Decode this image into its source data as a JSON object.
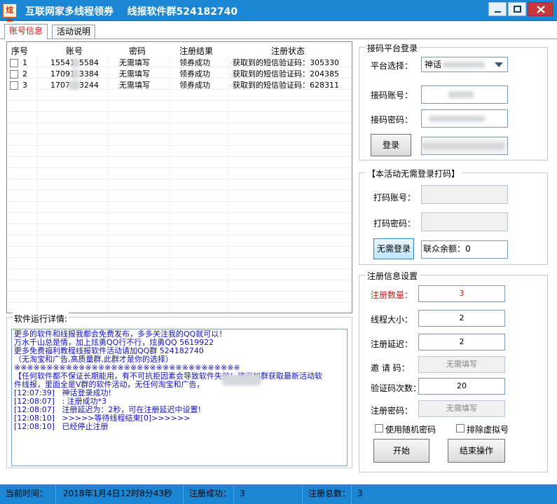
{
  "window": {
    "icon_text": "炫勇",
    "title": "互联网家多线程领券    线报软件群524182740",
    "controls": [
      "minimize",
      "maximize",
      "close"
    ]
  },
  "tabs": [
    {
      "label": "账号信息",
      "active": true
    },
    {
      "label": "活动说明",
      "active": false
    }
  ],
  "accounts": {
    "columns": [
      "序号",
      "账号",
      "密码",
      "注册结果",
      "注册状态"
    ],
    "rows": [
      {
        "index": "1",
        "account_prefix": "15541",
        "account_suffix": "5584",
        "password": "无需填写",
        "result": "领券成功",
        "status": "获取到的短信验证码：305330"
      },
      {
        "index": "2",
        "account_prefix": "17091",
        "account_suffix": "3384",
        "password": "无需填写",
        "result": "领券成功",
        "status": "获取到的短信验证码：204385"
      },
      {
        "index": "3",
        "account_prefix": "1707",
        "account_suffix": "3244",
        "password": "无需填写",
        "result": "领券成功",
        "status": "获取到的短信验证码：628311"
      }
    ]
  },
  "log": {
    "title": "软件运行详情:",
    "lines": [
      "更多的软件和线报我都会免费发布，多多关注我的QQ就可以！",
      "万水千山总是情，加上炫勇QQ行不行，炫勇QQ 5619922",
      "更多免费福利教程线报软件活动请加QQ群 524182740",
      "（无淘宝和广告,高质量群,此群才是你的选择）",
      "※※※※※※※※※※※※※※※※※※※※※※※※※※※※※※※※※※※",
      "【任何软件都不保证长期能用，有不可抗拒因素会导致软件失效！建议加群获取最新活动软",
      "件线报，里面全是V群的软件活动，无任何淘宝和广告，",
      "[12:07:39]   神话登录成功!",
      "[12:08:07]   : 注册成功*3",
      "[12:08:07]   注册延迟为：2秒，可在注册延迟中设置!",
      "[12:08:10]   >>>>>等待线程结束[0]>>>>>>",
      "[12:08:10]   已经停止注册"
    ]
  },
  "sms_platform": {
    "title": "接码平台登录",
    "platform_label": "平台选择：",
    "platform_value": "神话",
    "account_label": "接码账号：",
    "password_label": "接码密码：",
    "login_button": "登录"
  },
  "captcha": {
    "title": "【本活动无需登录打码】",
    "account_label": "打码账号：",
    "password_label": "打码密码：",
    "login_button": "无需登录",
    "balance_text": "联众余额：0"
  },
  "registration": {
    "title": "注册信息设置",
    "count_label": "注册数量：",
    "count_value": "3",
    "threads_label": "线程大小：",
    "threads_value": "2",
    "delay_label": "注册延迟：",
    "delay_value": "2",
    "invite_label": "邀 请 码：",
    "invite_value": "无需填写",
    "sms_attempts_label": "验证码次数：",
    "sms_attempts_value": "20",
    "password_label": "注册密码：",
    "password_value": "无需填写",
    "random_password_label": "使用随机密码",
    "exclude_virtual_label": "排除虚拟号",
    "start_button": "开始",
    "stop_button": "结束操作"
  },
  "status": {
    "time_label": "当前时间：",
    "time_value": "2018年1月4日12时8分43秒",
    "success_label": "注册成功：",
    "success_value": "3",
    "total_label": "注册总数：",
    "total_value": "3"
  },
  "colors": {
    "titlebar": "#1a86d4",
    "log_text": "#1010b8",
    "accent_red": "#c01818"
  }
}
